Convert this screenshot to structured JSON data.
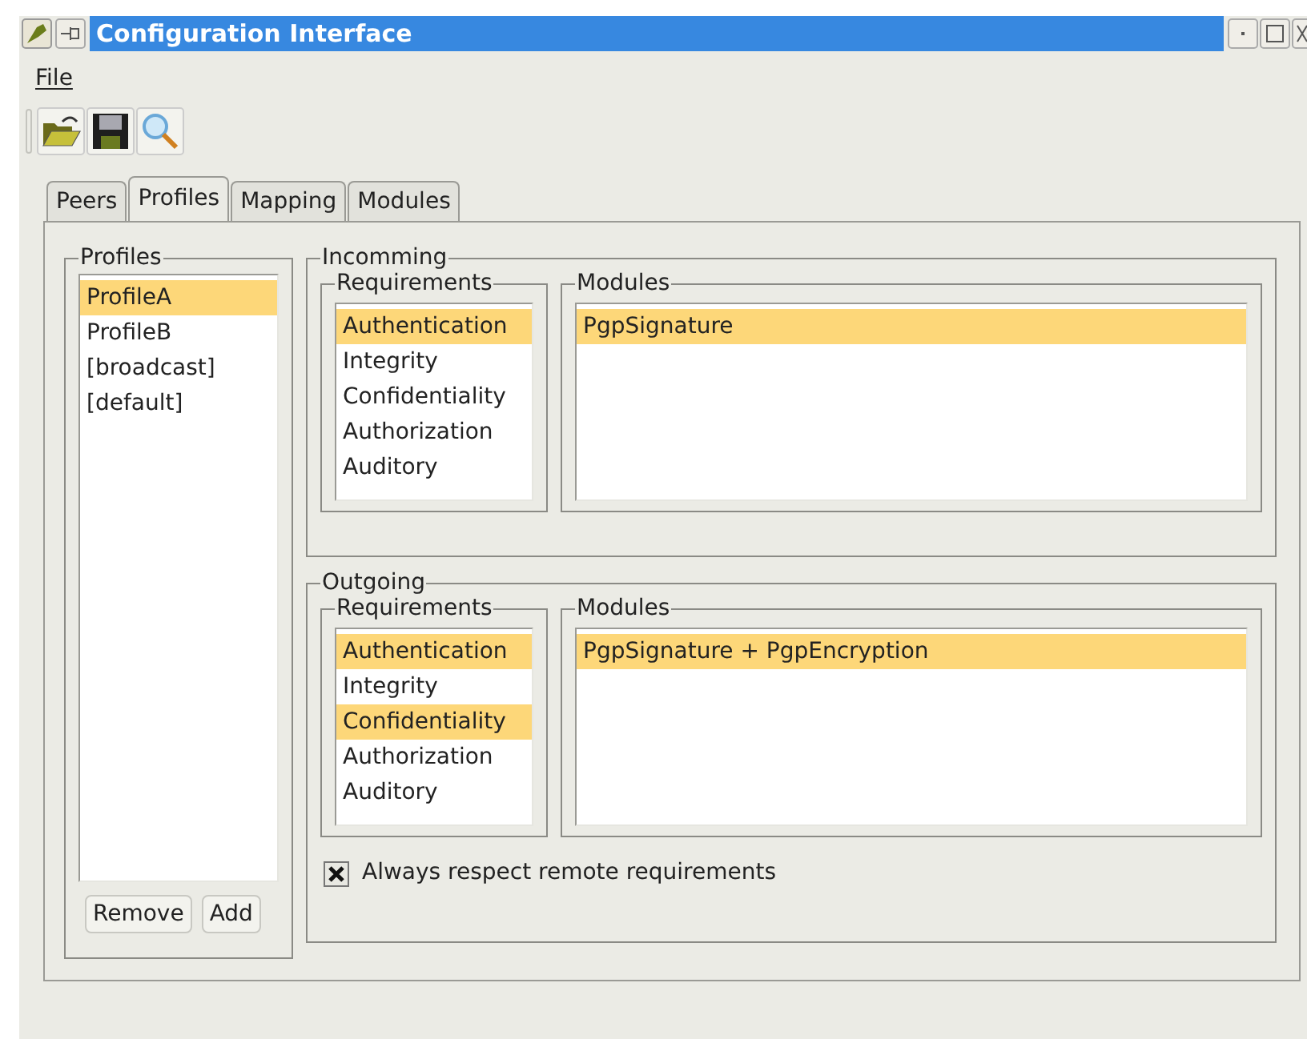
{
  "window": {
    "title": "Configuration Interface"
  },
  "menu": [
    "File"
  ],
  "tabs": [
    {
      "label": "Peers",
      "selected": false
    },
    {
      "label": "Profiles",
      "selected": true
    },
    {
      "label": "Mapping",
      "selected": false
    },
    {
      "label": "Modules",
      "selected": false
    }
  ],
  "profiles": {
    "title": "Profiles",
    "items": [
      {
        "label": "ProfileA",
        "selected": true
      },
      {
        "label": "ProfileB",
        "selected": false
      },
      {
        "label": "[broadcast]",
        "selected": false
      },
      {
        "label": "[default]",
        "selected": false
      }
    ],
    "buttons": [
      "Remove",
      "Add"
    ]
  },
  "sections": [
    {
      "title": "Incomming",
      "requirements": {
        "title": "Requirements",
        "items": [
          {
            "label": "Authentication",
            "selected": true
          },
          {
            "label": "Integrity",
            "selected": false
          },
          {
            "label": "Confidentiality",
            "selected": false
          },
          {
            "label": "Authorization",
            "selected": false
          },
          {
            "label": "Auditory",
            "selected": false
          }
        ]
      },
      "modules": {
        "title": "Modules",
        "items": [
          {
            "label": "PgpSignature",
            "selected": true
          }
        ]
      }
    },
    {
      "title": "Outgoing",
      "requirements": {
        "title": "Requirements",
        "items": [
          {
            "label": "Authentication",
            "selected": true
          },
          {
            "label": "Integrity",
            "selected": false
          },
          {
            "label": "Confidentiality",
            "selected": true
          },
          {
            "label": "Authorization",
            "selected": false
          },
          {
            "label": "Auditory",
            "selected": false
          }
        ]
      },
      "modules": {
        "title": "Modules",
        "items": [
          {
            "label": "PgpSignature + PgpEncryption",
            "selected": true
          }
        ]
      },
      "option": {
        "label": "Always respect remote requirements",
        "checked": true
      }
    }
  ]
}
